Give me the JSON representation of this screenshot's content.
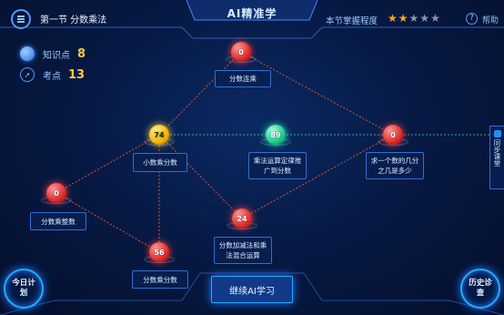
{
  "header": {
    "section_title": "第一节 分数乘法",
    "app_title": "AI精准学",
    "mastery_label": "本节掌握程度",
    "mastery_stars": 2,
    "mastery_max": 5,
    "help_label": "帮助"
  },
  "stats": {
    "knowledge_label": "知识点",
    "knowledge_count": "8",
    "exam_label": "考点",
    "exam_count": "13"
  },
  "nodes": [
    {
      "id": "n1",
      "score": "0",
      "color": "red",
      "label": "分数连乘"
    },
    {
      "id": "n2",
      "score": "74",
      "color": "gold",
      "label": "小数乘分数"
    },
    {
      "id": "n3",
      "score": "89",
      "color": "green",
      "label": "乘法运算定律推广到分数"
    },
    {
      "id": "n4",
      "score": "0",
      "color": "red",
      "label": "求一个数的几分之几是多少"
    },
    {
      "id": "n5",
      "score": "0",
      "color": "red",
      "label": "分数乘整数"
    },
    {
      "id": "n6",
      "score": "24",
      "color": "red",
      "label": "分数加减法和乘法混合运算"
    },
    {
      "id": "n7",
      "score": "56",
      "color": "red",
      "label": "分数乘分数"
    }
  ],
  "side_tab": {
    "label": "同步课堂"
  },
  "buttons": {
    "today_plan": "今日计划",
    "history": "历史诊查",
    "continue": "继续AI学习"
  },
  "colors": {
    "accent": "#2aa8ff",
    "star_on": "#f7a51c",
    "star_off": "#8a93a8",
    "count": "#ffc93c"
  }
}
